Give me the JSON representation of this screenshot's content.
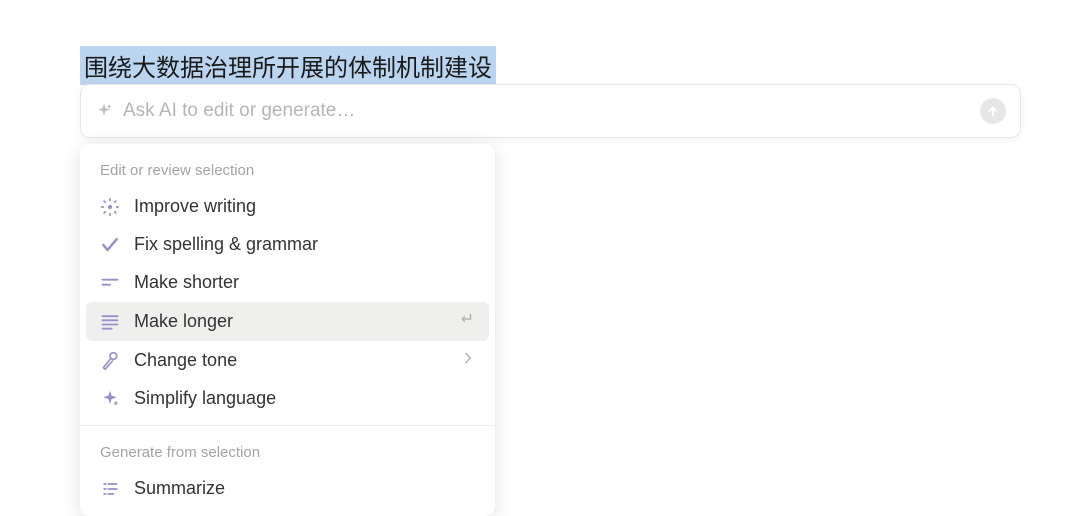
{
  "selected_text": "围绕大数据治理所开展的体制机制建设",
  "input": {
    "placeholder": "Ask AI to edit or generate…"
  },
  "sections": {
    "edit_review": {
      "label": "Edit or review selection",
      "items": {
        "improve_writing": "Improve writing",
        "fix_spelling": "Fix spelling & grammar",
        "make_shorter": "Make shorter",
        "make_longer": "Make longer",
        "change_tone": "Change tone",
        "simplify": "Simplify language"
      }
    },
    "generate": {
      "label": "Generate from selection",
      "items": {
        "summarize": "Summarize"
      }
    }
  }
}
